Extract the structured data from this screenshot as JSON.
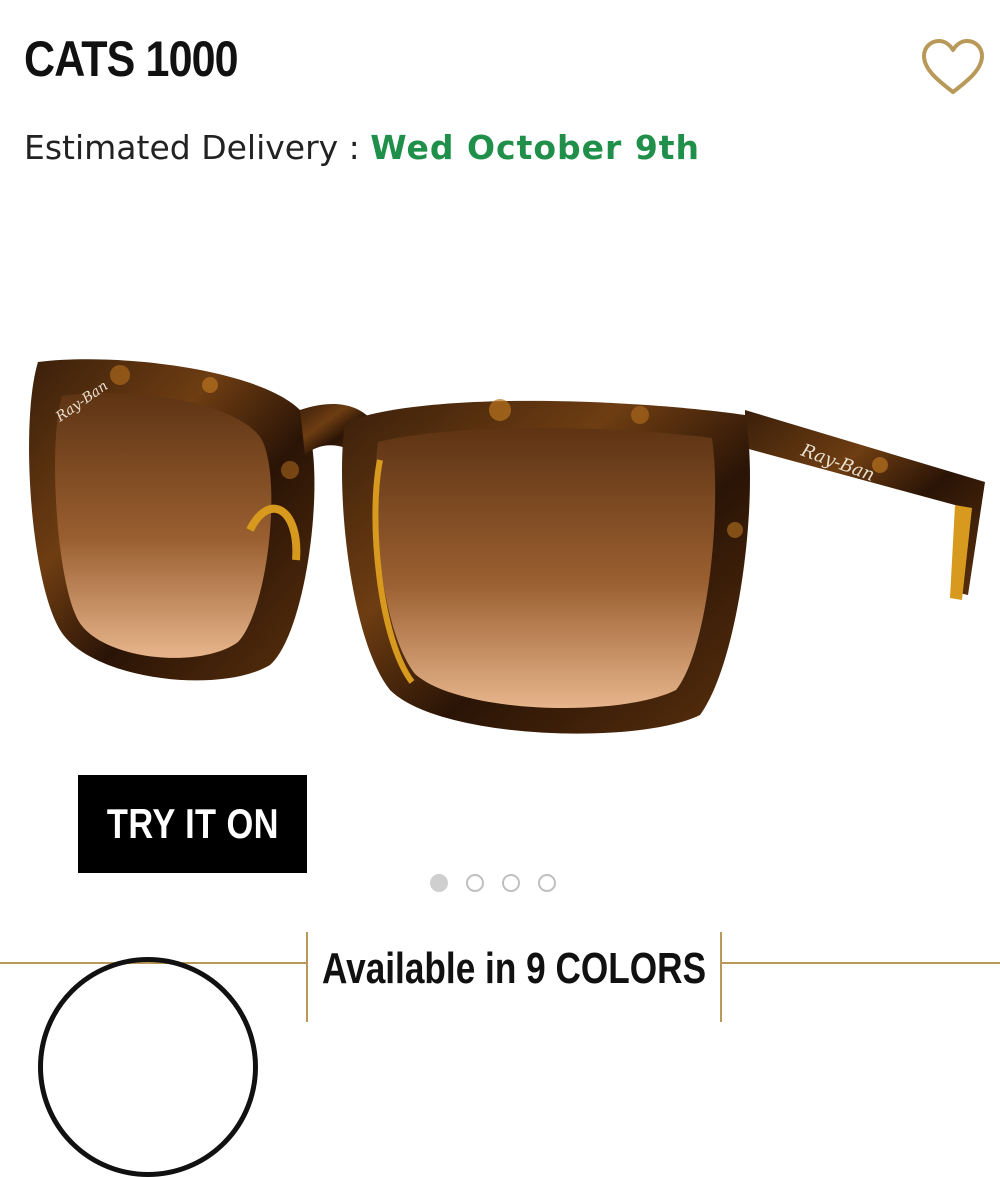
{
  "product": {
    "name": "CATS 1000",
    "delivery_label": "Estimated Delivery : ",
    "delivery_date": "Wed October 9th",
    "image_alt": "Tortoise sunglasses with brown gradient lenses",
    "brand_mark": "Ray-Ban"
  },
  "actions": {
    "try_on_label": "TRY IT ON",
    "favorite_icon": "heart-outline-icon"
  },
  "carousel": {
    "total": 4,
    "active_index": 0
  },
  "colors": {
    "available_label": "Available in 9 COLORS"
  },
  "theme": {
    "delivery_date_color": "#1f8f4a",
    "accent_gold": "#b8995a"
  }
}
